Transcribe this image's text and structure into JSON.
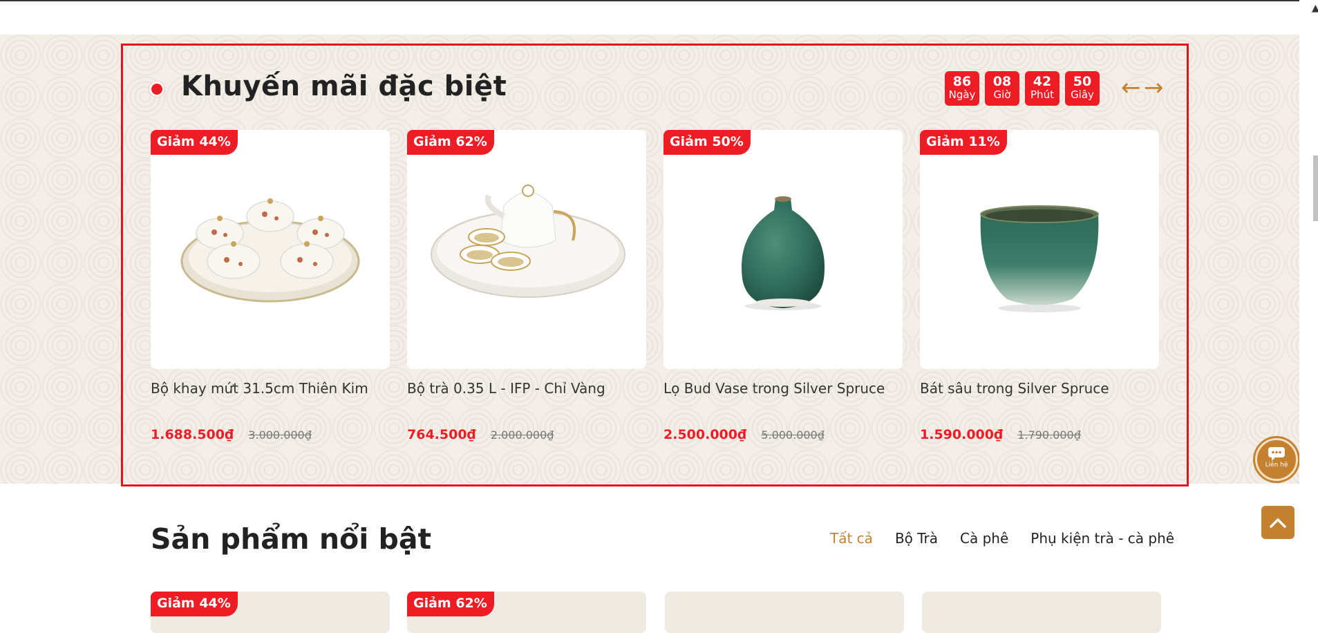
{
  "promo": {
    "title": "Khuyến mãi đặc biệt",
    "countdown": [
      {
        "value": "86",
        "label": "Ngày"
      },
      {
        "value": "08",
        "label": "Giờ"
      },
      {
        "value": "42",
        "label": "Phút"
      },
      {
        "value": "50",
        "label": "Giây"
      }
    ],
    "prev_arrow": "←",
    "next_arrow": "→",
    "products": [
      {
        "badge": "Giảm 44%",
        "name": "Bộ khay mứt 31.5cm Thiên Kim",
        "price": "1.688.500₫",
        "old_price": "3.000.000₫"
      },
      {
        "badge": "Giảm 62%",
        "name": "Bộ trà 0.35 L - IFP - Chỉ Vàng",
        "price": "764.500₫",
        "old_price": "2.000.000₫"
      },
      {
        "badge": "Giảm 50%",
        "name": "Lọ Bud Vase trong Silver Spruce",
        "price": "2.500.000₫",
        "old_price": "5.000.000₫"
      },
      {
        "badge": "Giảm 11%",
        "name": "Bát sâu trong Silver Spruce",
        "price": "1.590.000₫",
        "old_price": "1.790.000₫"
      }
    ]
  },
  "featured": {
    "title": "Sản phẩm nổi bật",
    "filters": [
      {
        "label": "Tất cả",
        "active": true
      },
      {
        "label": "Bộ Trà",
        "active": false
      },
      {
        "label": "Cà phê",
        "active": false
      },
      {
        "label": "Phụ kiện trà - cà phê",
        "active": false
      }
    ],
    "cards": [
      {
        "badge": "Giảm 44%"
      },
      {
        "badge": "Giảm 62%"
      },
      {
        "badge": ""
      },
      {
        "badge": ""
      }
    ]
  },
  "widgets": {
    "contact_label": "Liên hệ"
  },
  "colors": {
    "accent_red": "#ee1c25",
    "accent_gold": "#c4812f",
    "highlight_border": "#e0141e",
    "vase_green": "#2f6b5a"
  },
  "icons": [
    "arrow-left-icon",
    "arrow-right-icon",
    "chat-icon",
    "chevron-up-icon"
  ]
}
